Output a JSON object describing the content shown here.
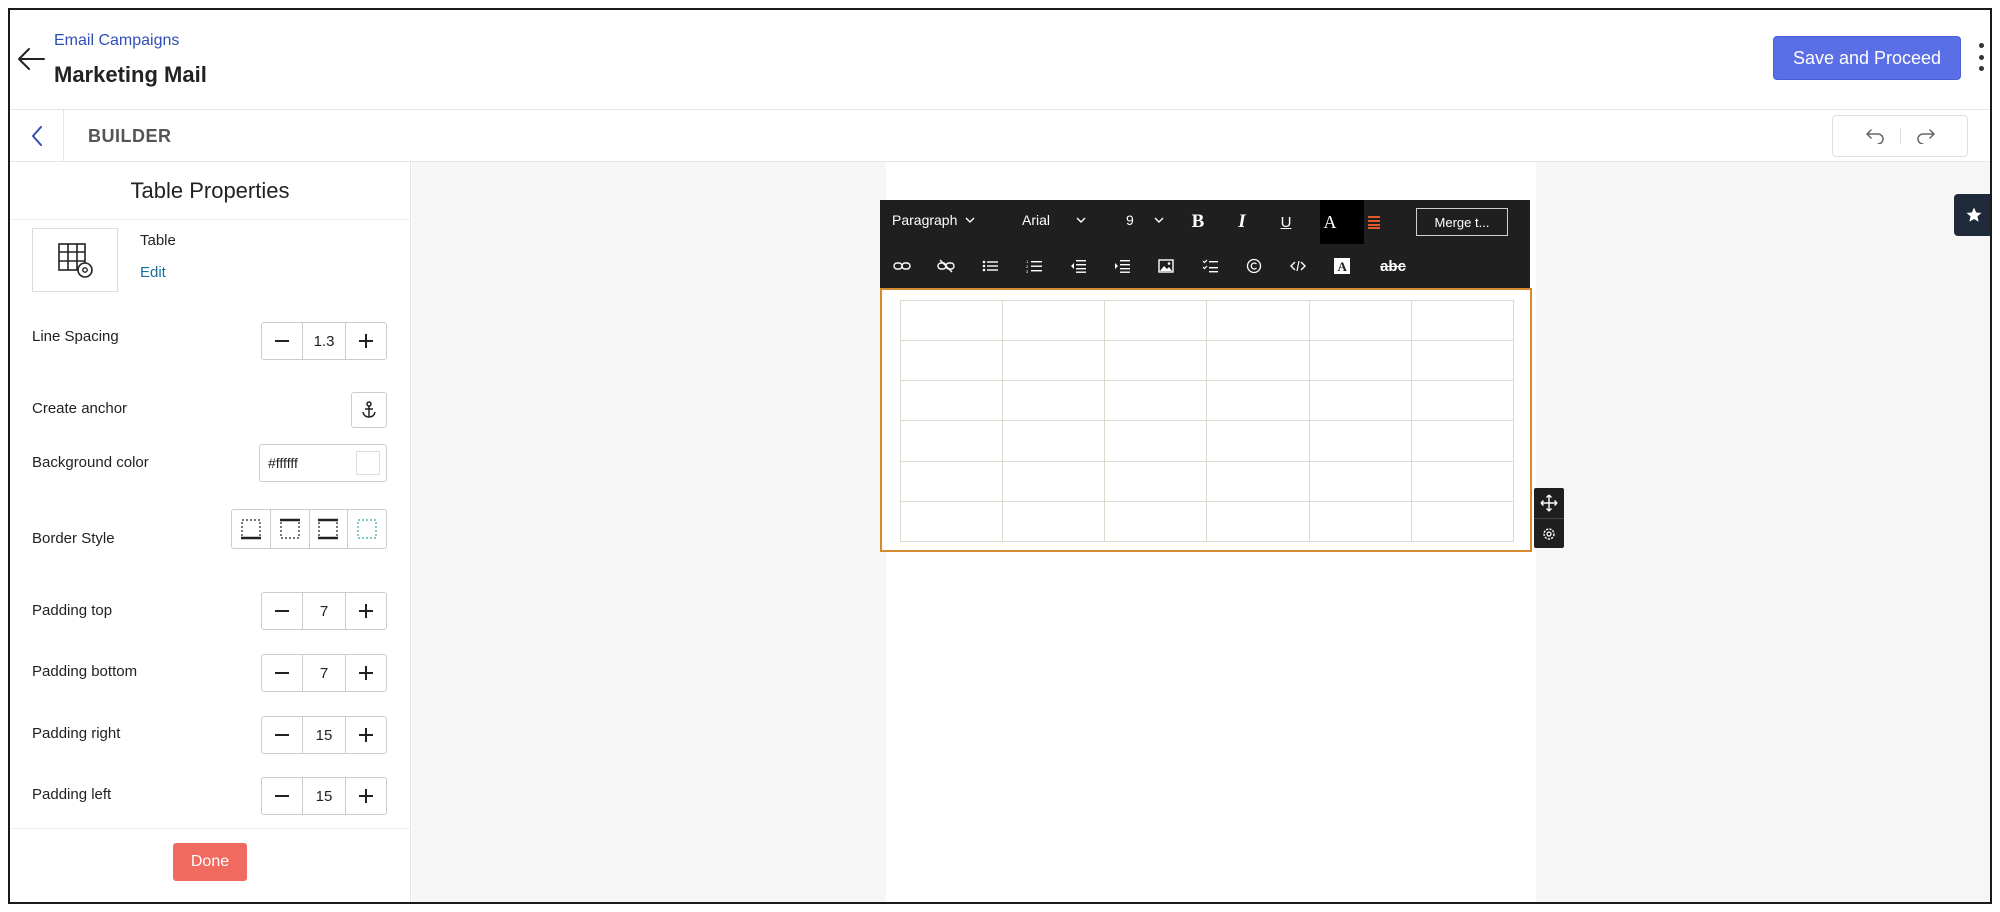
{
  "header": {
    "breadcrumb": "Email Campaigns",
    "title": "Marketing Mail",
    "save_label": "Save and Proceed"
  },
  "builder": {
    "label": "BUILDER"
  },
  "panel": {
    "title": "Table Properties",
    "block_name": "Table",
    "edit_label": "Edit",
    "line_spacing": {
      "label": "Line Spacing",
      "value": "1.3"
    },
    "create_anchor": {
      "label": "Create anchor"
    },
    "background_color": {
      "label": "Background color",
      "value": "#ffffff"
    },
    "border_style": {
      "label": "Border Style"
    },
    "padding_top": {
      "label": "Padding top",
      "value": "7"
    },
    "padding_bottom": {
      "label": "Padding bottom",
      "value": "7"
    },
    "padding_right": {
      "label": "Padding right",
      "value": "15"
    },
    "padding_left": {
      "label": "Padding left",
      "value": "15"
    },
    "done_label": "Done"
  },
  "toolbar": {
    "format": "Paragraph",
    "font": "Arial",
    "size": "9",
    "merge_label": "Merge t...",
    "spellcheck": "abc"
  },
  "table": {
    "rows": 6,
    "cols": 6
  },
  "colors": {
    "primary": "#5a6ee6",
    "done": "#f16a5f",
    "link": "#2f4fb5",
    "selection": "#d68a2e",
    "toolbar_bg": "#1f1f1f"
  }
}
